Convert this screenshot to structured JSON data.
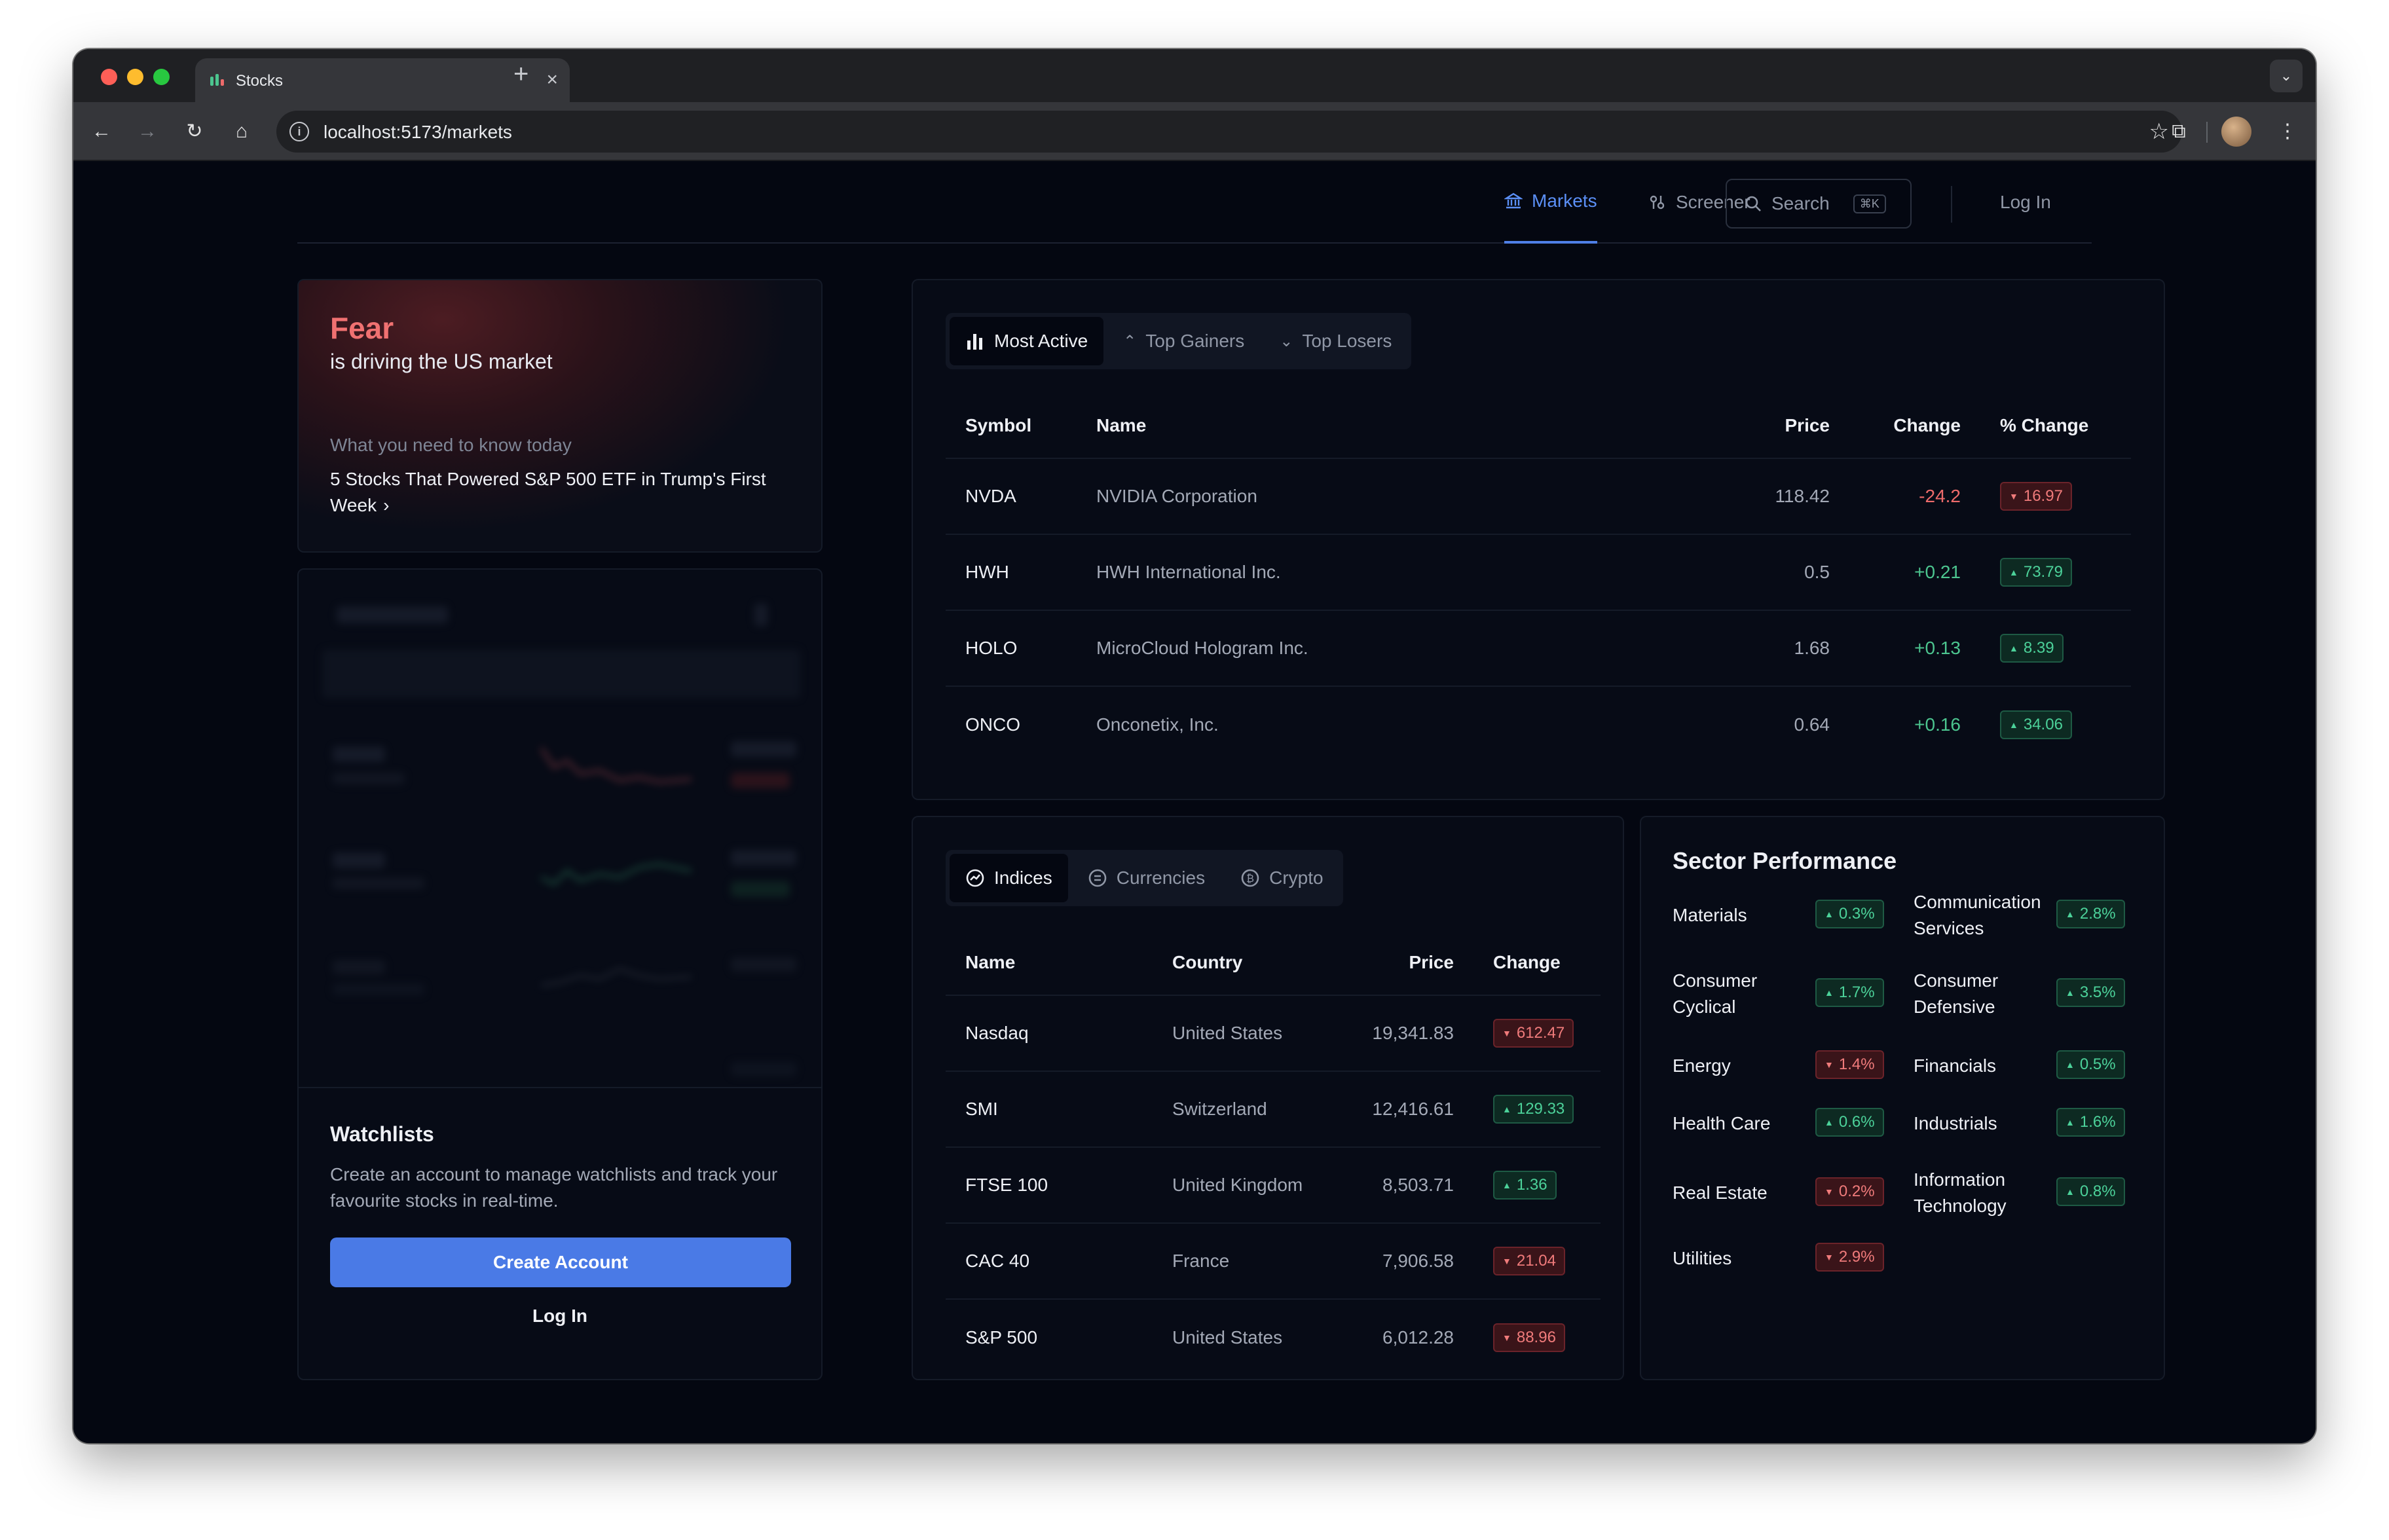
{
  "browser": {
    "tab_title": "Stocks",
    "tab_close": "×",
    "new_tab": "+",
    "url": "localhost:5173/markets"
  },
  "nav": {
    "markets": "Markets",
    "screener": "Screener",
    "search": "Search",
    "search_shortcut": "⌘K",
    "login": "Log In"
  },
  "fear": {
    "title": "Fear",
    "subtitle": "is driving the US market",
    "know": "What you need to know today",
    "headline": "5 Stocks That Powered S&P 500 ETF in Trump's First Week"
  },
  "watchlists": {
    "title": "Watchlists",
    "description": "Create an account to manage watchlists and track your favourite stocks in real-time.",
    "create": "Create Account",
    "login": "Log In"
  },
  "movers": {
    "tabs": [
      "Most Active",
      "Top Gainers",
      "Top Losers"
    ],
    "headers": [
      "Symbol",
      "Name",
      "Price",
      "Change",
      "% Change"
    ],
    "rows": [
      {
        "symbol": "NVDA",
        "name": "NVIDIA Corporation",
        "price": "118.42",
        "change": "-24.2",
        "pct": "16.97",
        "dir": "down"
      },
      {
        "symbol": "HWH",
        "name": "HWH International Inc.",
        "price": "0.5",
        "change": "+0.21",
        "pct": "73.79",
        "dir": "up"
      },
      {
        "symbol": "HOLO",
        "name": "MicroCloud Hologram Inc.",
        "price": "1.68",
        "change": "+0.13",
        "pct": "8.39",
        "dir": "up"
      },
      {
        "symbol": "ONCO",
        "name": "Onconetix, Inc.",
        "price": "0.64",
        "change": "+0.16",
        "pct": "34.06",
        "dir": "up"
      }
    ]
  },
  "indices": {
    "tabs": [
      "Indices",
      "Currencies",
      "Crypto"
    ],
    "headers": [
      "Name",
      "Country",
      "Price",
      "Change"
    ],
    "rows": [
      {
        "name": "Nasdaq",
        "country": "United States",
        "price": "19,341.83",
        "change": "612.47",
        "dir": "down"
      },
      {
        "name": "SMI",
        "country": "Switzerland",
        "price": "12,416.61",
        "change": "129.33",
        "dir": "up"
      },
      {
        "name": "FTSE 100",
        "country": "United Kingdom",
        "price": "8,503.71",
        "change": "1.36",
        "dir": "up"
      },
      {
        "name": "CAC 40",
        "country": "France",
        "price": "7,906.58",
        "change": "21.04",
        "dir": "down"
      },
      {
        "name": "S&P 500",
        "country": "United States",
        "price": "6,012.28",
        "change": "88.96",
        "dir": "down"
      }
    ]
  },
  "sectors": {
    "title": "Sector Performance",
    "items": [
      {
        "name": "Materials",
        "value": "0.3%",
        "dir": "up"
      },
      {
        "name": "Communication Services",
        "value": "2.8%",
        "dir": "up"
      },
      {
        "name": "Consumer Cyclical",
        "value": "1.7%",
        "dir": "up"
      },
      {
        "name": "Consumer Defensive",
        "value": "3.5%",
        "dir": "up"
      },
      {
        "name": "Energy",
        "value": "1.4%",
        "dir": "down"
      },
      {
        "name": "Financials",
        "value": "0.5%",
        "dir": "up"
      },
      {
        "name": "Health Care",
        "value": "0.6%",
        "dir": "up"
      },
      {
        "name": "Industrials",
        "value": "1.6%",
        "dir": "up"
      },
      {
        "name": "Real Estate",
        "value": "0.2%",
        "dir": "down"
      },
      {
        "name": "Information Technology",
        "value": "0.8%",
        "dir": "up"
      },
      {
        "name": "Utilities",
        "value": "2.9%",
        "dir": "down"
      }
    ]
  },
  "colors": {
    "accent": "#4a7ae6",
    "positive": "#4cc58f",
    "negative": "#ee6b6b",
    "background": "#040711"
  }
}
